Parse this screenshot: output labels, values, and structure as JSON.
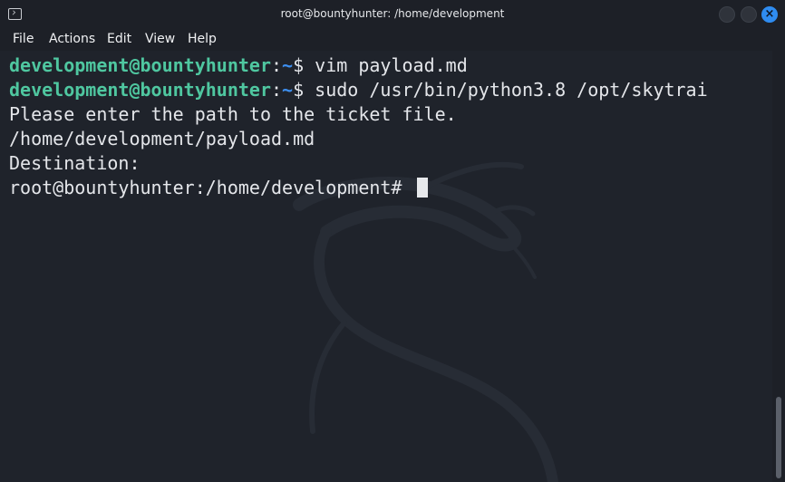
{
  "window": {
    "title": "root@bountyhunter: /home/development"
  },
  "menu": {
    "items": [
      "File",
      "Actions",
      "Edit",
      "View",
      "Help"
    ]
  },
  "terminal": {
    "line1": {
      "user_host": "development@bountyhunter",
      "colon": ":",
      "path": "~",
      "symbol": "$",
      "command": " vim payload.md"
    },
    "line2": {
      "user_host": "development@bountyhunter",
      "colon": ":",
      "path": "~",
      "symbol": "$",
      "command": " sudo /usr/bin/python3.8 /opt/skytrai"
    },
    "line3": "Please enter the path to the ticket file.",
    "line4": "/home/development/payload.md",
    "line5": "Destination:",
    "line6": "root@bountyhunter:/home/development# "
  },
  "icons": {
    "app": "terminal-icon",
    "minimize": "minimize-icon",
    "maximize": "maximize-icon",
    "close": "close-icon"
  },
  "colors": {
    "background": "#1f232b",
    "prompt_user": "#4fc7a0",
    "prompt_path": "#3d8ff0",
    "text": "#e4e6ea",
    "close_button": "#2f8cf0"
  }
}
